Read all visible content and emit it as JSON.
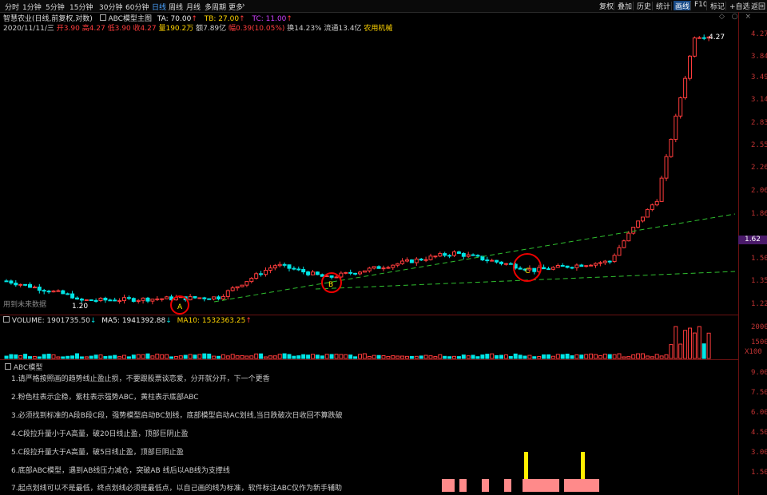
{
  "toolbar": {
    "periods": [
      "分时",
      "1分钟",
      "5分钟",
      "15分钟",
      "30分钟",
      "60分钟",
      "日线",
      "周线",
      "月线",
      "多周期",
      "更多"
    ],
    "active_period": "日线",
    "right_buttons": [
      "复权",
      "叠加",
      "历史",
      "统计",
      "画线",
      "F10",
      "标记",
      "+自选",
      "返回"
    ],
    "active_right": "画线"
  },
  "header": {
    "stock": "智慧农业(日线,前复权,对数)",
    "indicator_name": "ABC模型主图",
    "ta": "TA: 70.00",
    "tb": "TB: 27.00",
    "tc": "TC: 11.00",
    "date": "2020/11/11/三",
    "open": "开3.90",
    "high": "高4.27",
    "low": "低3.90",
    "close": "收4.27",
    "volume": "量190.2万",
    "amount": "额7.89亿",
    "change": "幅0.39(10.05%)",
    "turnover": "换14.23%",
    "float": "流通13.4亿",
    "sector": "农用机械"
  },
  "main_chart": {
    "price_axis": [
      "4.27",
      "3.84",
      "3.49",
      "3.14",
      "2.83",
      "2.55",
      "2.26",
      "2.06",
      "1.86",
      "1.62",
      "1.50",
      "1.35",
      "1.22"
    ],
    "current_price": "1.62",
    "high_label": "4.27",
    "low_label": "1.20",
    "watermark": "用到未来数据",
    "markers": {
      "a": "A",
      "b": "B",
      "c": "C"
    }
  },
  "volume_panel": {
    "volume": "VOLUME: 1901735.50",
    "ma5": "MA5: 1941392.88",
    "ma10": "MA10: 1532363.25",
    "axis": [
      "20000",
      "15000",
      "10000",
      "X100"
    ]
  },
  "abc_panel": {
    "title": "ABC模型",
    "notes": [
      "1.请严格按照画的趋势线止盈止损，不要跟股票谈恋爱，分开就分开，下一个更香",
      "2.粉色柱表示企稳，紫柱表示强势ABC，黄柱表示底部ABC",
      "3.必须找到标准的A段B段C段，强势模型启动BC划线，底部模型启动AC划线,当日跌破次日收回不算跌破",
      "4.C段拉升量小于A高量，破20日线止盈，顶部巨阴止盈",
      "5.C段拉升量大于A高量，破5日线止盈，顶部巨阴止盈",
      "6.底部ABC模型，遇到AB线压力减仓，突破AB 线后以AB线为支撑线",
      "7.起点划线可以不是最低，终点划线必须是最低点，以自己画的线为标准，软件标注ABC仅作为新手辅助"
    ],
    "axis": [
      "9.00",
      "7.50",
      "6.00",
      "4.50",
      "3.00",
      "1.50"
    ]
  },
  "colors": {
    "up": "#ff3c3c",
    "down": "#00e5e5",
    "panel_border": "#6b1111",
    "green_line": "#2fbf2f",
    "pink": "#ff8a8a",
    "yellow": "#ffee00"
  }
}
